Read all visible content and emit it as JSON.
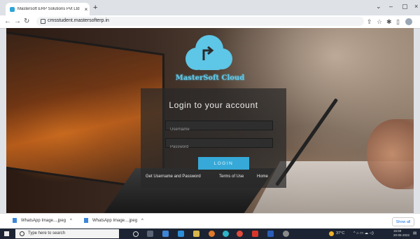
{
  "browser": {
    "tab_title": "Mastersoft ERP Solutions Pvt Ltd",
    "tab_close": "×",
    "new_tab": "+",
    "url": "cmsstudent.mastersofterp.in",
    "window_controls": [
      "⌄",
      "–",
      "▢",
      "×"
    ]
  },
  "page": {
    "brand": "MasterSoft Cloud",
    "login_title": "Login to your account",
    "username_placeholder": "Username",
    "password_placeholder": "Password",
    "login_button": "LOGIN",
    "links": {
      "get_username": "Get Username and Password",
      "terms": "Terms of Use",
      "home": "Home"
    },
    "colors": {
      "accent": "#36a9d8",
      "brand": "#5ec6e6",
      "panel": "#282828"
    }
  },
  "downloads": {
    "items": [
      {
        "name": "WhatsApp Image....jpeg",
        "icon": "image-file-icon"
      },
      {
        "name": "WhatsApp Image....jpeg",
        "icon": "image-file-icon"
      }
    ],
    "show_all": "Show all"
  },
  "taskbar": {
    "search_placeholder": "Type here to search",
    "weather": "37°C",
    "time": "16:59",
    "date": "20-05-2022"
  }
}
